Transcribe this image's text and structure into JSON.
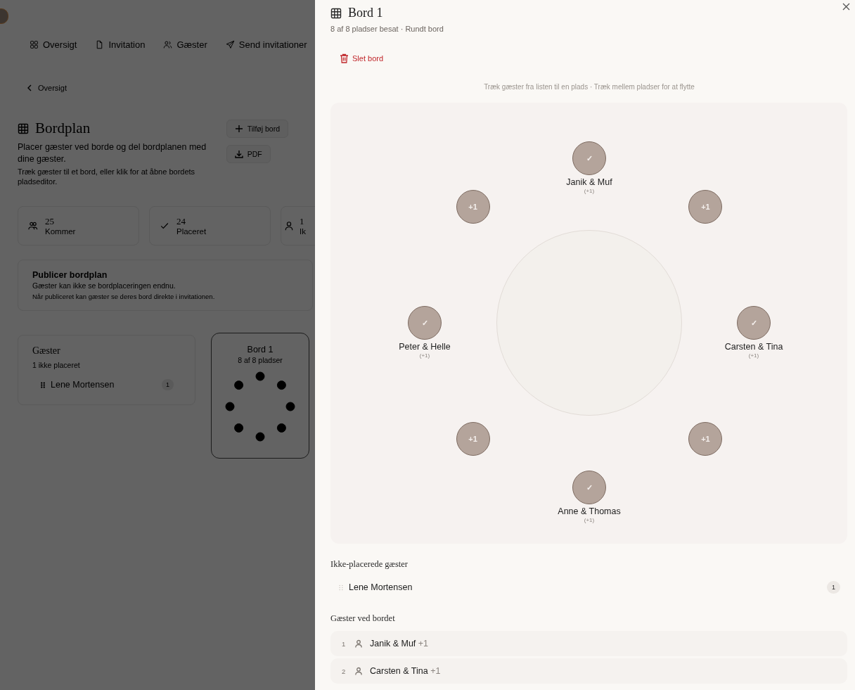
{
  "background_page": {
    "nav_tabs": [
      {
        "label": "Oversigt"
      },
      {
        "label": "Invitation"
      },
      {
        "label": "Gæster"
      },
      {
        "label": "Send invitationer"
      }
    ],
    "back_link": "Oversigt",
    "title": "Bordplan",
    "description": "Placer gæster ved borde og del bordplanen med dine gæster.",
    "hint": "Træk gæster til et bord, eller klik for at åbne bordets pladseditor.",
    "buttons": [
      {
        "label": "Tilføj bord"
      },
      {
        "label": "PDF"
      }
    ],
    "stats": [
      {
        "value": "25",
        "label": "Kommer"
      },
      {
        "value": "24",
        "label": "Placeret"
      },
      {
        "value": "1",
        "label": "Ik"
      }
    ],
    "publish": {
      "title": "Publicer bordplan",
      "text": "Gæster kan ikke se bordplaceringen endnu.",
      "hint": "Når publiceret kan gæster se deres bord direkte i invitationen."
    },
    "guests": {
      "title": "Gæster",
      "subtitle": "1 ikke placeret",
      "items": [
        {
          "name": "Lene Mortensen",
          "count": "1"
        }
      ]
    },
    "table_card": {
      "name": "Bord 1",
      "capacity": "8 af 8 pladser"
    }
  },
  "panel": {
    "title": "Bord 1",
    "subtitle": "8 af 8 pladser besat · Rundt bord",
    "delete_button": "Slet bord",
    "hint": "Træk gæster fra listen til en plads · Træk mellem pladser for at flytte",
    "seats": [
      {
        "kind": "guest",
        "mark": "✓",
        "name": "Janik & Muf",
        "note": "(+1)"
      },
      {
        "kind": "plus_one",
        "mark": "+1"
      },
      {
        "kind": "guest",
        "mark": "✓",
        "name": "Carsten & Tina",
        "note": "(+1)"
      },
      {
        "kind": "plus_one",
        "mark": "+1"
      },
      {
        "kind": "guest",
        "mark": "✓",
        "name": "Anne & Thomas",
        "note": "(+1)"
      },
      {
        "kind": "plus_one",
        "mark": "+1"
      },
      {
        "kind": "guest",
        "mark": "✓",
        "name": "Peter & Helle",
        "note": "(+1)"
      },
      {
        "kind": "plus_one",
        "mark": "+1"
      }
    ],
    "unplaced_title": "Ikke-placerede gæster",
    "unplaced": [
      {
        "name": "Lene Mortensen",
        "count": "1"
      }
    ],
    "seated_title": "Gæster ved bordet",
    "seated": [
      {
        "number": "1",
        "name": "Janik & Muf",
        "extra": "+1"
      },
      {
        "number": "2",
        "name": "Carsten & Tina",
        "extra": "+1"
      }
    ]
  }
}
